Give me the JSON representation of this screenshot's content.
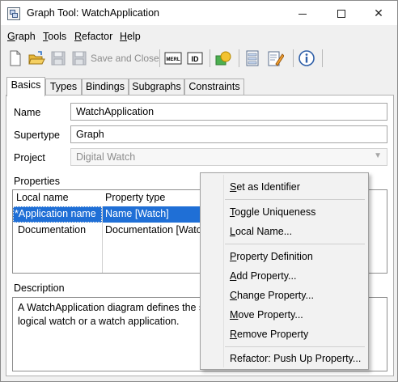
{
  "window": {
    "title": "Graph Tool: WatchApplication",
    "icon": "graph-tool-icon"
  },
  "menubar": [
    {
      "mnemonic": "G",
      "rest": "raph"
    },
    {
      "mnemonic": "T",
      "rest": "ools"
    },
    {
      "mnemonic": "R",
      "rest": "efactor"
    },
    {
      "mnemonic": "H",
      "rest": "elp"
    }
  ],
  "toolbar": {
    "save_and_close_label": "Save and Close",
    "merl_label": "MERL",
    "id_label": "ID",
    "icons": [
      "new-icon",
      "open-icon",
      "save-icon",
      "save-and-close-icon",
      "merl-icon",
      "id-icon",
      "symbol-editor-icon",
      "dialog-editor-icon",
      "edit-text-icon",
      "info-icon"
    ]
  },
  "tabs": [
    "Basics",
    "Types",
    "Bindings",
    "Subgraphs",
    "Constraints"
  ],
  "form": {
    "name_label": "Name",
    "name_value": "WatchApplication",
    "supertype_label": "Supertype",
    "supertype_value": "Graph",
    "project_label": "Project",
    "project_value": "Digital Watch"
  },
  "properties": {
    "label": "Properties",
    "columns": [
      "Local name",
      "Property type"
    ],
    "rows": [
      {
        "local_name": "*Application name",
        "property_type": "Name [Watch]"
      },
      {
        "local_name": "Documentation",
        "property_type": "Documentation [Watc"
      }
    ]
  },
  "description": {
    "label": "Description",
    "line1": "A WatchApplication diagram defines the st",
    "line2": "logical watch or a watch application."
  },
  "context_menu": {
    "items": [
      {
        "mnemonic": "S",
        "rest": "et as Identifier"
      },
      {
        "mnemonic": "T",
        "rest": "oggle Uniqueness"
      },
      {
        "mnemonic": "L",
        "rest": "ocal Name..."
      },
      {
        "mnemonic": "P",
        "rest": "roperty Definition"
      },
      {
        "mnemonic": "A",
        "rest": "dd Property..."
      },
      {
        "mnemonic": "C",
        "rest": "hange Property..."
      },
      {
        "mnemonic": "M",
        "rest": "ove Property..."
      },
      {
        "mnemonic": "R",
        "rest": "emove Property"
      },
      {
        "mnemonic": "",
        "rest": "Refactor: Push Up Property..."
      }
    ]
  },
  "colors": {
    "selection": "#1f6fd6",
    "accent_yellow": "#f2c230",
    "info_blue": "#2f5fa8"
  }
}
